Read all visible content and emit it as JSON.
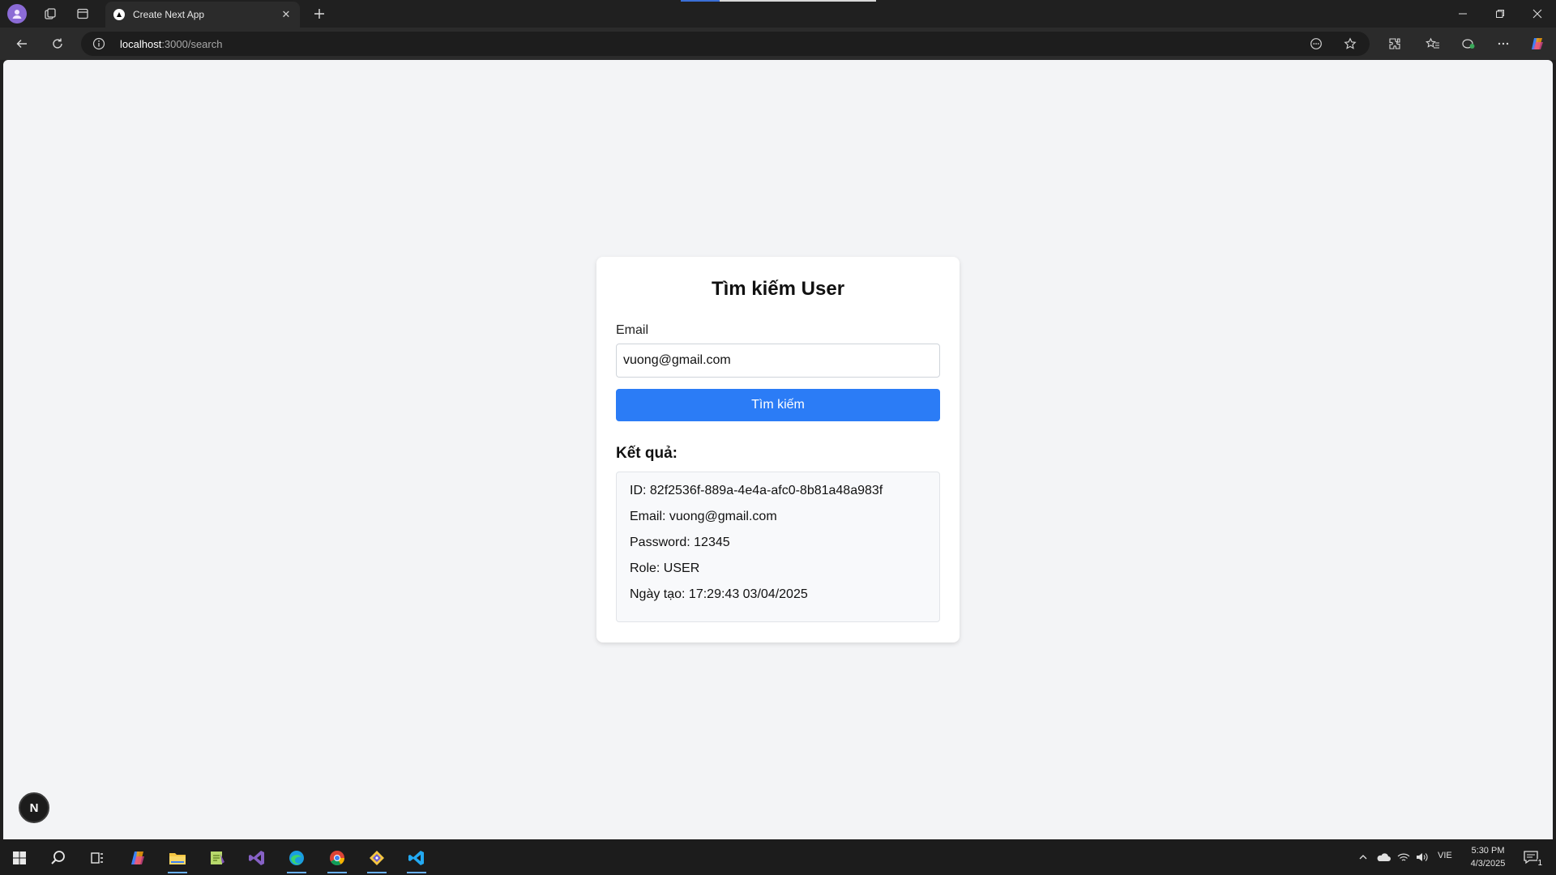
{
  "browser": {
    "tab_title": "Create Next App",
    "url_host": "localhost",
    "url_path": ":3000/search"
  },
  "page": {
    "title": "Tìm kiếm User",
    "email_label": "Email",
    "email_value": "vuong@gmail.com",
    "search_button": "Tìm kiếm",
    "result_heading": "Kết quả:",
    "result": {
      "id": "ID: 82f2536f-889a-4e4a-afc0-8b81a48a983f",
      "email": "Email: vuong@gmail.com",
      "password": "Password: 12345",
      "role": "Role: USER",
      "created": "Ngày tạo: 17:29:43 03/04/2025"
    },
    "next_badge": "N"
  },
  "taskbar": {
    "language": "VIE",
    "time": "5:30 PM",
    "date": "4/3/2025",
    "notification_count": "1"
  },
  "colors": {
    "accent_button": "#2b7cf6",
    "page_background": "#f3f4f6",
    "browser_chrome": "#202020"
  }
}
